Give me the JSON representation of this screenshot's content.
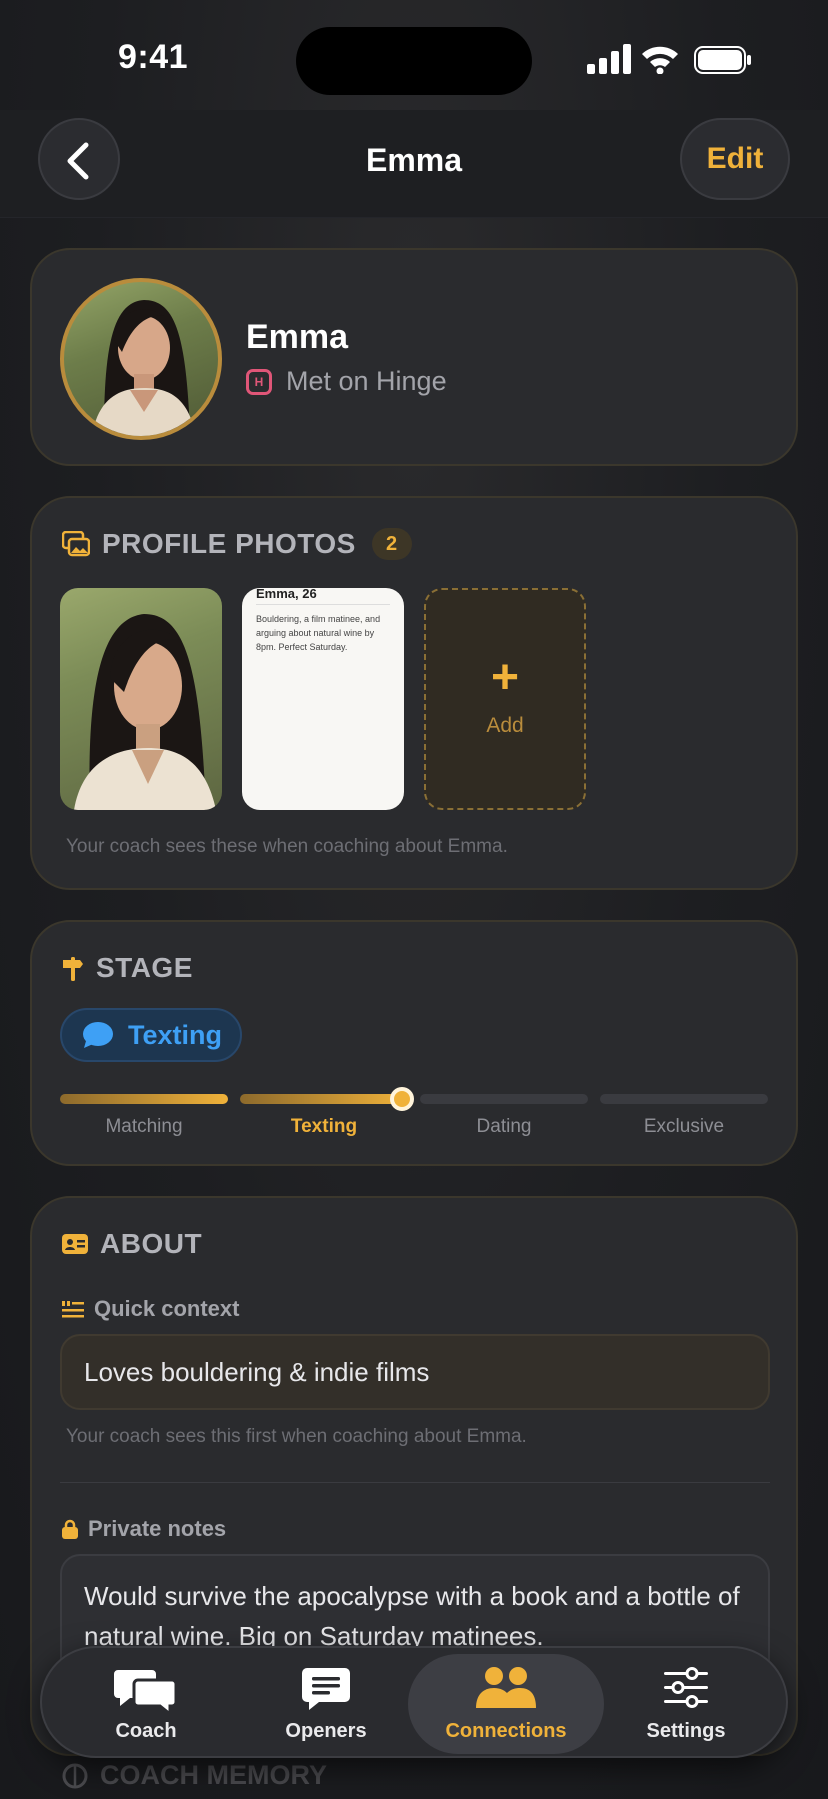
{
  "status": {
    "time": "9:41"
  },
  "nav": {
    "title": "Emma",
    "edit_label": "Edit"
  },
  "profile": {
    "name": "Emma",
    "met_on": "Met on Hinge",
    "source_icon_letter": "H"
  },
  "photos": {
    "heading": "PROFILE PHOTOS",
    "count": "2",
    "screenshot_title": "Emma, 26",
    "screenshot_body": "Bouldering, a film matinee, and arguing about natural wine by 8pm. Perfect Saturday.",
    "add_label": "Add",
    "add_icon": "+",
    "hint": "Your coach sees these when coaching about Emma."
  },
  "stage": {
    "heading": "STAGE",
    "current": "Texting",
    "steps": [
      "Matching",
      "Texting",
      "Dating",
      "Exclusive"
    ],
    "progress_fraction": 0.5
  },
  "about": {
    "heading": "ABOUT",
    "quick_context_label": "Quick context",
    "quick_context_value": "Loves bouldering & indie films",
    "quick_context_hint": "Your coach sees this first when coaching about Emma.",
    "private_notes_label": "Private notes",
    "private_notes_value": "Would survive the apocalypse with a book and a bottle of natural wine. Big on Saturday matinees."
  },
  "coach_memory": {
    "heading": "COACH MEMORY"
  },
  "tabs": [
    {
      "label": "Coach",
      "icon": "chat-bubbles-icon",
      "active": false
    },
    {
      "label": "Openers",
      "icon": "message-lines-icon",
      "active": false
    },
    {
      "label": "Connections",
      "icon": "people-icon",
      "active": true
    },
    {
      "label": "Settings",
      "icon": "sliders-icon",
      "active": false
    }
  ],
  "colors": {
    "accent": "#f0b23a",
    "stage_blue": "#3ea0f5",
    "hinge_pink": "#e05678",
    "background": "#1c1d20"
  }
}
